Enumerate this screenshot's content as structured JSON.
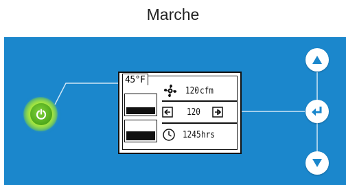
{
  "caption": "Marche",
  "display": {
    "temperature": "45°F",
    "airflow_value": "120",
    "airflow_unit": "cfm",
    "setpoint_value": "120",
    "hours_value": "1245",
    "hours_unit": "hrs"
  },
  "icons": {
    "power": "power-icon",
    "fan": "fan-icon",
    "decrease": "arrow-left-box-icon",
    "increase": "plus-box-icon",
    "clock": "clock-icon",
    "up": "triangle-up-icon",
    "enter": "enter-arrow-icon",
    "down": "triangle-down-icon"
  },
  "colors": {
    "panel": "#1b87cc",
    "power_glow": "#9fe03a",
    "nav_icon": "#1b87cc"
  },
  "tanks": [
    {
      "level": 0.45
    },
    {
      "level": 0.55
    }
  ]
}
